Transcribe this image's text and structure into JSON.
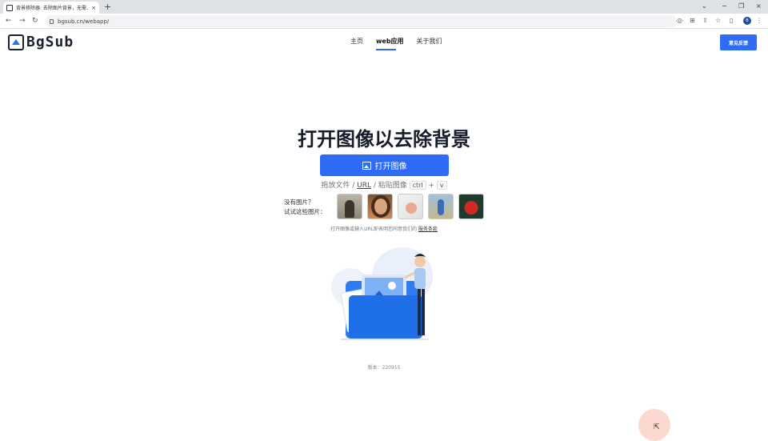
{
  "browser": {
    "tab_title": "背景移除器: 去除图片背景，无需上传",
    "tab_close": "×",
    "new_tab": "+",
    "url": "bgsub.cn/webapp/",
    "win_min": "⌄",
    "win_restore": "−",
    "win_max": "❐",
    "win_close": "×",
    "profile_initial": "B"
  },
  "site": {
    "logo": "BgSub",
    "nav": [
      "主页",
      "web应用",
      "关于我们"
    ],
    "feedback": "意见反馈"
  },
  "hero": {
    "title": "打开图像以去除背景",
    "open_button": "打开图像",
    "drop_prefix": "拖放文件 / ",
    "drop_url": "URL",
    "drop_mid": " / 粘贴图像 ",
    "key_ctrl": "ctrl",
    "key_plus": " + ",
    "key_v": "v",
    "try_line1": "没有图片？",
    "try_line2": "试试这些图片：",
    "terms_prefix": "打开图像或输入URL即表明您同意我们的 ",
    "terms_link": "服务条款",
    "version": "版本：220915"
  },
  "colors": {
    "accent": "#2f6cf6",
    "dark": "#171c2a"
  }
}
